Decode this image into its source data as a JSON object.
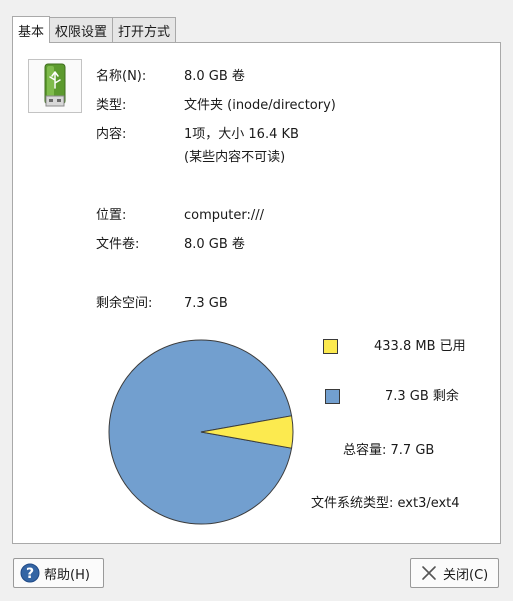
{
  "tabs": [
    {
      "label": "基本",
      "active": true
    },
    {
      "label": "权限设置",
      "active": false
    },
    {
      "label": "打开方式",
      "active": false
    }
  ],
  "drive_icon": "usb-drive-icon",
  "info": {
    "name_label": "名称(N):",
    "name_value": "8.0 GB 卷",
    "type_label": "类型:",
    "type_value": "文件夹 (inode/directory)",
    "contents_label": "内容:",
    "contents_value": "1项，大小 16.4 KB",
    "contents_note": "(某些内容不可读)",
    "location_label": "位置:",
    "location_value": "computer:///",
    "volume_label": "文件卷:",
    "volume_value": "8.0 GB 卷",
    "free_label": "剩余空间:",
    "free_value": "7.3 GB"
  },
  "usage": {
    "used_text": "433.8 MB 已用",
    "free_text": "7.3 GB 剩余",
    "capacity_text": "总容量:  7.7 GB",
    "filesystem_text": "文件系统类型:   ext3/ext4",
    "used_fraction": 0.0563,
    "colors": {
      "used": "#fcea4f",
      "free": "#729fcf",
      "outline": "#3c3c3c"
    }
  },
  "buttons": {
    "help_label": "帮助(H)",
    "help_icon": "help-icon",
    "close_label": "关闭(C)",
    "close_icon": "close-icon"
  }
}
